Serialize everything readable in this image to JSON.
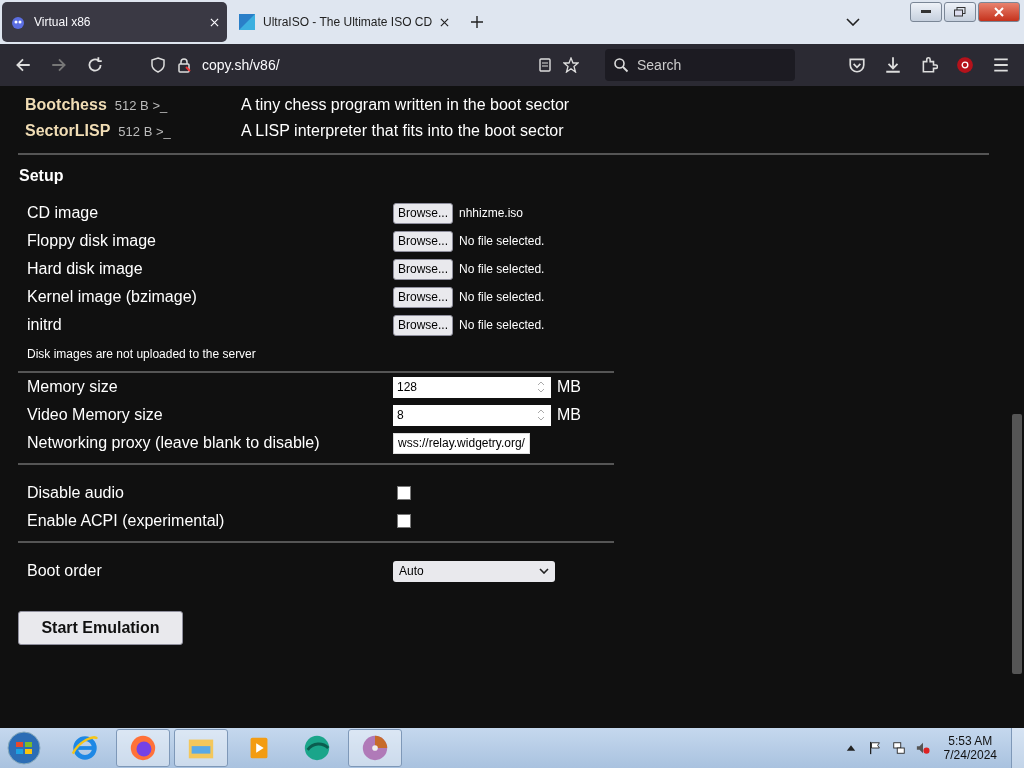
{
  "browser": {
    "tabs": [
      {
        "title": "Virtual x86",
        "selected": true
      },
      {
        "title": "UltraISO - The Ultimate ISO CD",
        "selected": false
      }
    ],
    "address": "copy.sh/v86/",
    "search": {
      "placeholder": "Search"
    }
  },
  "os_list": [
    {
      "name": "Bootchess",
      "size": "512 B >_",
      "description": "A tiny chess program written in the boot sector"
    },
    {
      "name": "SectorLISP",
      "size": "512 B >_",
      "description": "A LISP interpreter that fits into the boot sector"
    }
  ],
  "setup": {
    "heading": "Setup",
    "files": [
      {
        "label": "CD image",
        "button": "Browse...",
        "status": "nhhizme.iso"
      },
      {
        "label": "Floppy disk image",
        "button": "Browse...",
        "status": "No file selected."
      },
      {
        "label": "Hard disk image",
        "button": "Browse...",
        "status": "No file selected."
      },
      {
        "label": "Kernel image (bzimage)",
        "button": "Browse...",
        "status": "No file selected."
      },
      {
        "label": "initrd",
        "button": "Browse...",
        "status": "No file selected."
      }
    ],
    "note": "Disk images are not uploaded to the server",
    "fields": [
      {
        "label": "Memory size",
        "kind": "number",
        "value": "128",
        "unit": "MB"
      },
      {
        "label": "Video Memory size",
        "kind": "number",
        "value": "8",
        "unit": "MB"
      },
      {
        "label": "Networking proxy (leave blank to disable)",
        "kind": "text",
        "value": "wss://relay.widgetry.org/"
      }
    ],
    "options": [
      {
        "label": "Disable audio",
        "checked": false
      },
      {
        "label": "Enable ACPI (experimental)",
        "checked": false
      }
    ],
    "boot_order": {
      "label": "Boot order",
      "value": "Auto"
    },
    "start_button": "Start Emulation"
  },
  "taskbar": {
    "time": "5:53 AM",
    "date": "7/24/2024"
  }
}
